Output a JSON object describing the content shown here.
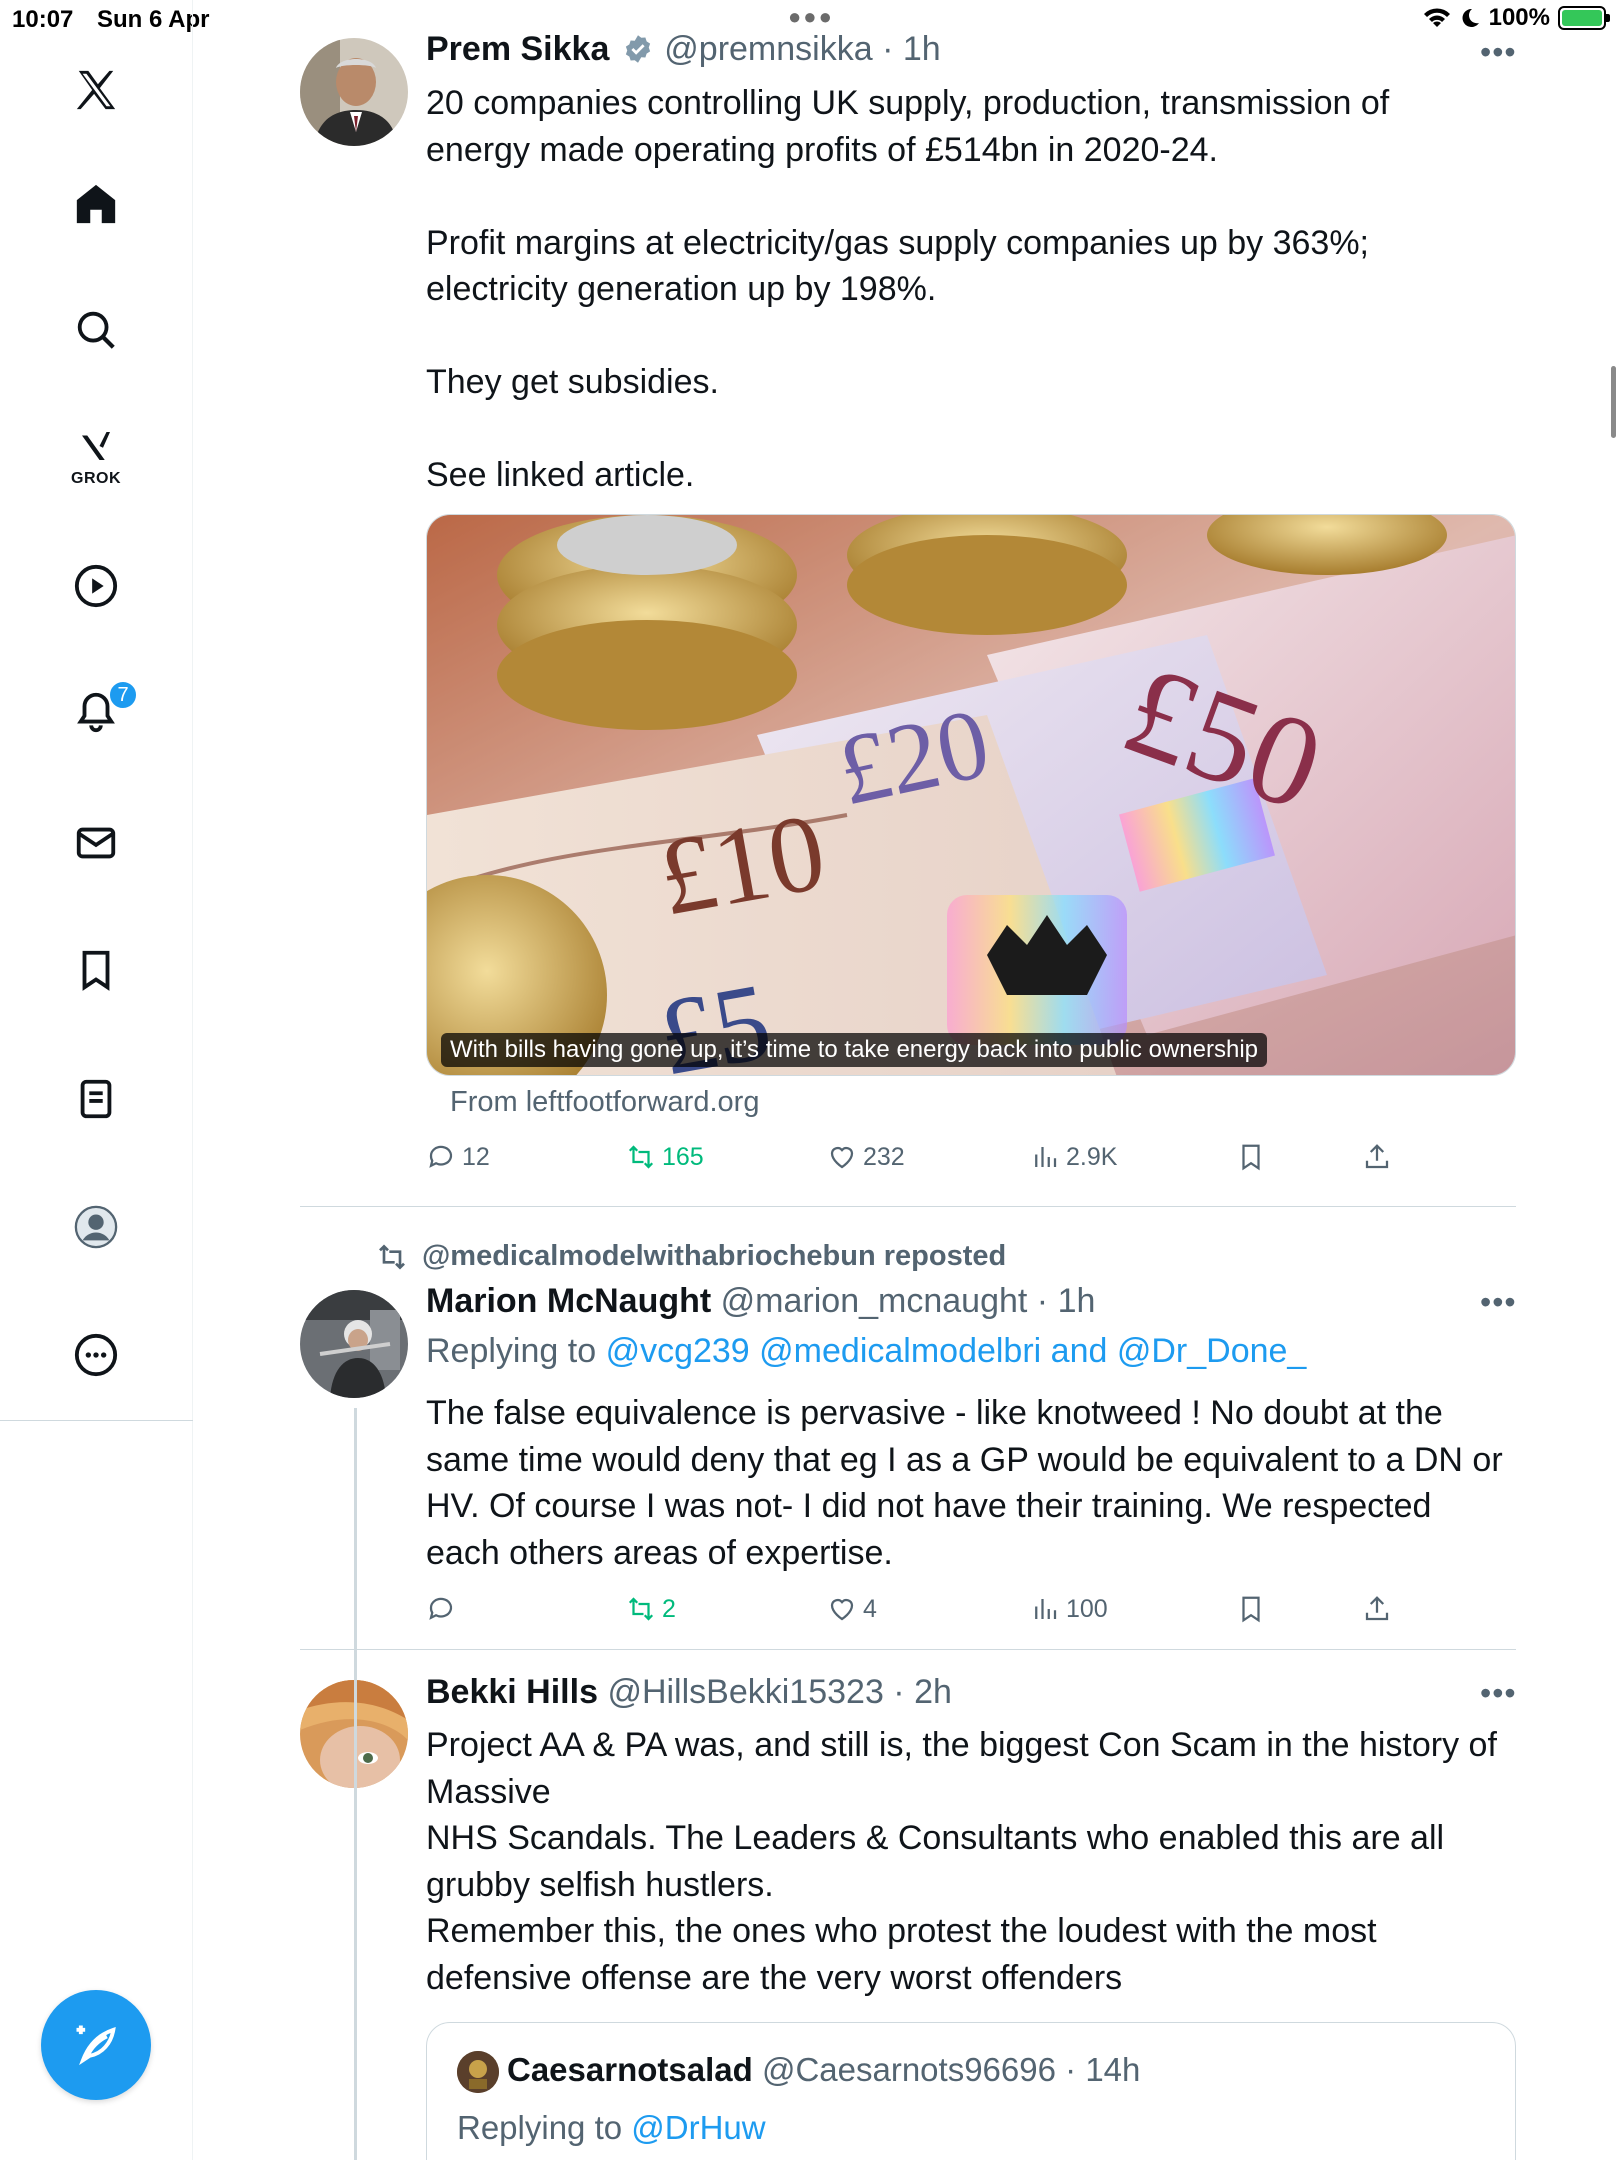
{
  "status_bar": {
    "time": "10:07",
    "date": "Sun 6 Apr",
    "battery": "100%"
  },
  "sidebar": {
    "items": [
      {
        "name": "home",
        "icon": "home-icon"
      },
      {
        "name": "explore",
        "icon": "search-icon"
      },
      {
        "name": "grok",
        "icon": "grok-icon",
        "label": "GROK"
      },
      {
        "name": "video",
        "icon": "play-icon"
      },
      {
        "name": "notifications",
        "icon": "bell-icon",
        "badge": "7"
      },
      {
        "name": "messages",
        "icon": "mail-icon"
      },
      {
        "name": "bookmarks",
        "icon": "bookmark-icon"
      },
      {
        "name": "lists",
        "icon": "list-icon"
      },
      {
        "name": "profile",
        "icon": "profile-icon"
      },
      {
        "name": "more",
        "icon": "more-circle-icon"
      }
    ],
    "compose_icon": "compose-icon"
  },
  "tweets": [
    {
      "name": "Prem Sikka",
      "verified": true,
      "handle": "@premnsikka",
      "time": "1h",
      "text_lines": [
        "20 companies controlling UK supply, production, transmission of",
        "energy made operating profits of £514bn in 2020-24.",
        "",
        "Profit margins at electricity/gas supply companies up by 363%;",
        "electricity generation up by 198%.",
        "",
        "They get subsidies.",
        "",
        "See linked article."
      ],
      "card": {
        "caption": "With bills having gone up, it’s time to take energy back into public ownership",
        "source": "From leftfootforward.org"
      },
      "stats": {
        "replies": "12",
        "reposts": "165",
        "likes": "232",
        "views": "2.9K"
      }
    },
    {
      "repost_by": "@medicalmodelwithabriochebun reposted",
      "name": "Marion McNaught",
      "handle": "@marion_mcnaught",
      "time": "1h",
      "reply_prefix": "Replying to",
      "reply_to": "@vcg239 @medicalmodelbri and @Dr_Done_",
      "text_lines": [
        "The false equivalence is pervasive - like knotweed ! No doubt at the",
        "same time would deny that eg I as a GP would be equivalent to a DN or",
        "HV. Of course I was not- I did not have their training. We respected",
        "each others areas of expertise."
      ],
      "stats": {
        "replies": "",
        "reposts": "2",
        "likes": "4",
        "views": "100"
      }
    },
    {
      "name": "Bekki Hills",
      "handle": "@HillsBekki15323",
      "time": "2h",
      "text_lines": [
        "Project AA & PA was, and still is, the biggest Con Scam in the history of",
        "Massive",
        "NHS Scandals. The Leaders & Consultants who enabled this are all",
        "grubby selfish hustlers.",
        "Remember this, the ones who protest the loudest with the most",
        "defensive offense are the very worst offenders"
      ],
      "quote": {
        "name": "Caesarnotsalad",
        "handle": "@Caesarnots96696",
        "time": "14h",
        "reply_prefix": "Replying to",
        "reply_to": "@DrHuw"
      }
    }
  ]
}
